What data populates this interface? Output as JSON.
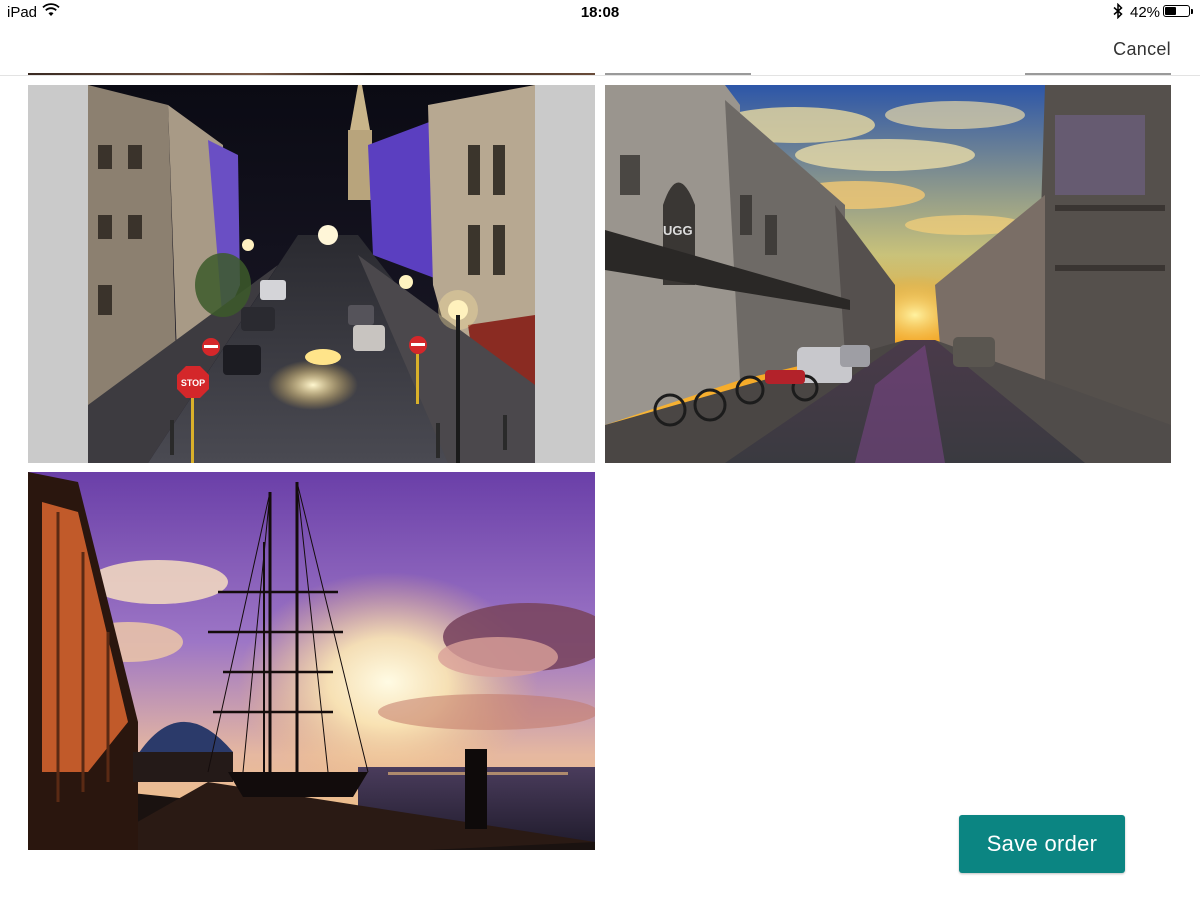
{
  "status_bar": {
    "device": "iPad",
    "time": "18:08",
    "battery_percent": "42%",
    "battery_level": 0.42,
    "icons": [
      "wifi-icon",
      "bluetooth-icon",
      "battery-icon"
    ]
  },
  "nav": {
    "cancel_label": "Cancel"
  },
  "photos": [
    {
      "name": "night-street-stop-sign",
      "stop_sign_text": "STOP"
    },
    {
      "name": "sunset-street-shops",
      "shop_sign_text": "UGG"
    },
    {
      "name": "tall-ship-sunset"
    }
  ],
  "actions": {
    "save_label": "Save order"
  },
  "colors": {
    "accent": "#0b8582",
    "cancel_text": "#333333"
  }
}
